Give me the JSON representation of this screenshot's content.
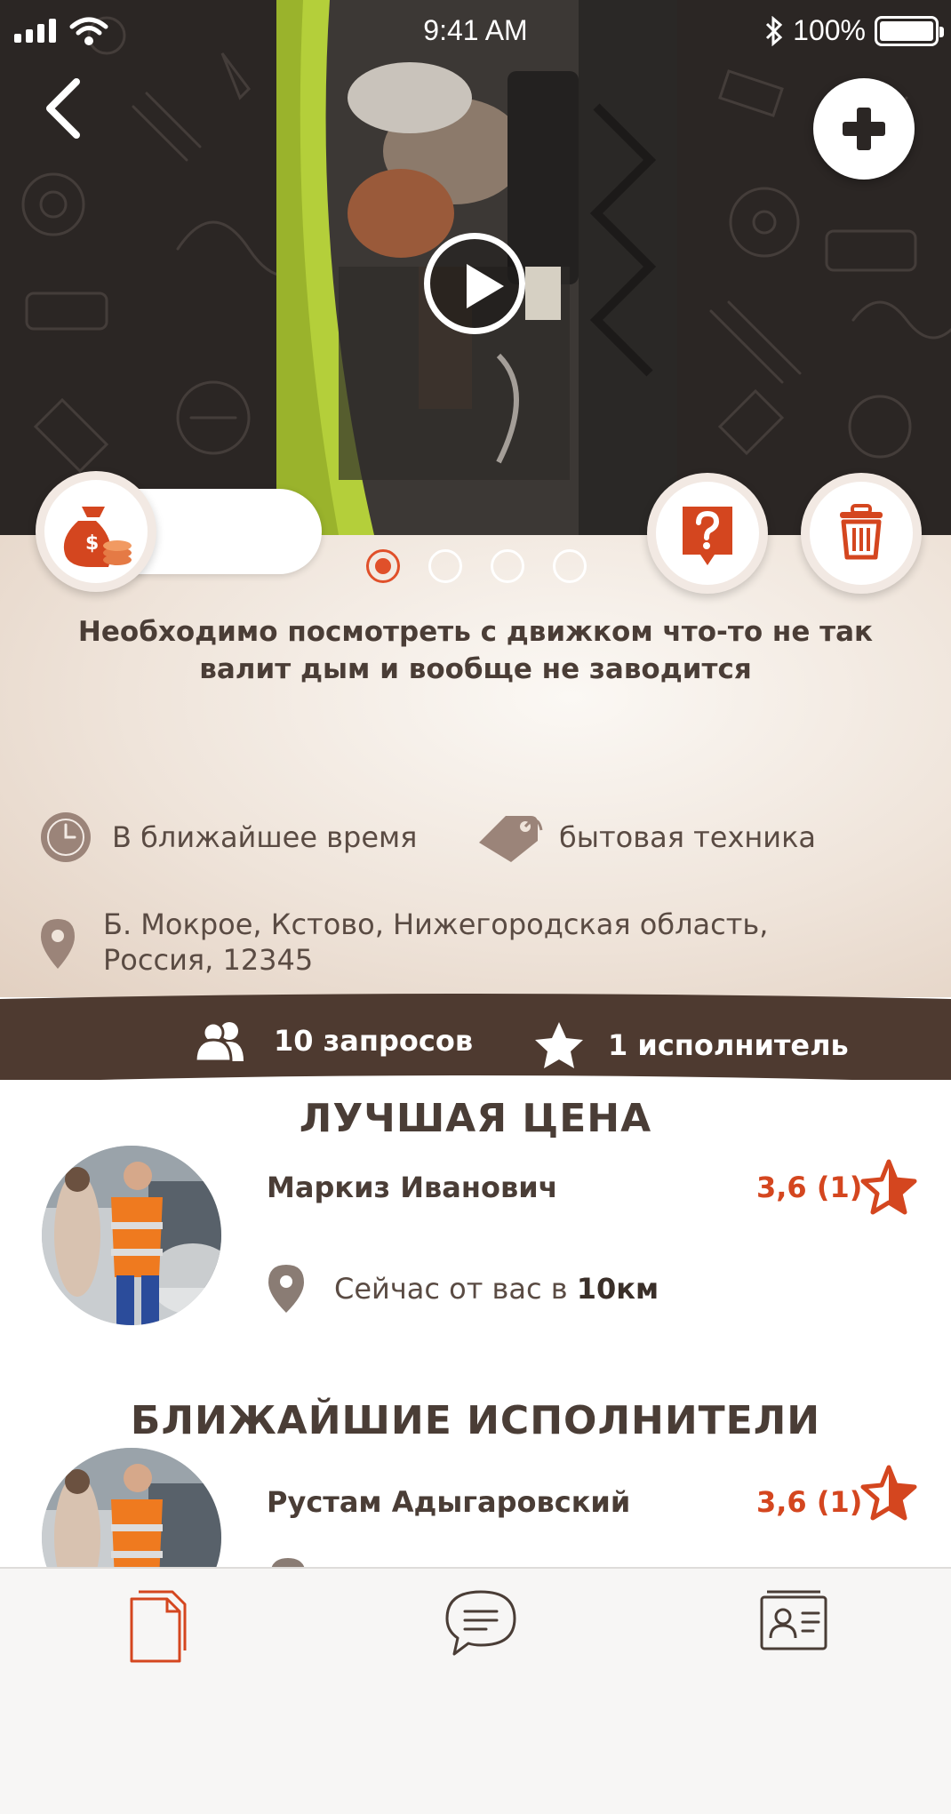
{
  "status_bar": {
    "time": "9:41 AM",
    "battery": "100%"
  },
  "gallery": {
    "slides_count": 4,
    "active_slide": 1
  },
  "order": {
    "description": "Необходимо посмотреть с движком что-то не так валит дым и вообще не заводится",
    "time": "В ближайшее время",
    "category": "бытовая техника",
    "address": "Б. Мокрое, Кстово, Нижегородская область, Россия, 12345"
  },
  "stats": {
    "requests": "10 запросов",
    "executors": "1 исполнитель"
  },
  "best_price": {
    "title": "ЛУЧШАЯ ЦЕНА",
    "worker": {
      "name": "Маркиз Иванович",
      "rating": "3,6 (1)",
      "distance_prefix": "Сейчас от вас  в",
      "distance_value": "10км"
    }
  },
  "nearest": {
    "title": "БЛИЖАЙШИЕ ИСПОЛНИТЕЛИ",
    "workers": [
      {
        "name": "Рустам Адыгаровский",
        "rating": "3,6 (1)"
      }
    ]
  },
  "tabs": [
    {
      "name": "orders",
      "icon": "documents-icon",
      "active": true
    },
    {
      "name": "chat",
      "icon": "chat-bubble-icon",
      "active": false
    },
    {
      "name": "profile",
      "icon": "id-card-icon",
      "active": false
    }
  ],
  "colors": {
    "accent": "#e0502a",
    "rating": "#d4461f",
    "brown": "#4e3a30",
    "hero_bg": "#2b2624"
  }
}
